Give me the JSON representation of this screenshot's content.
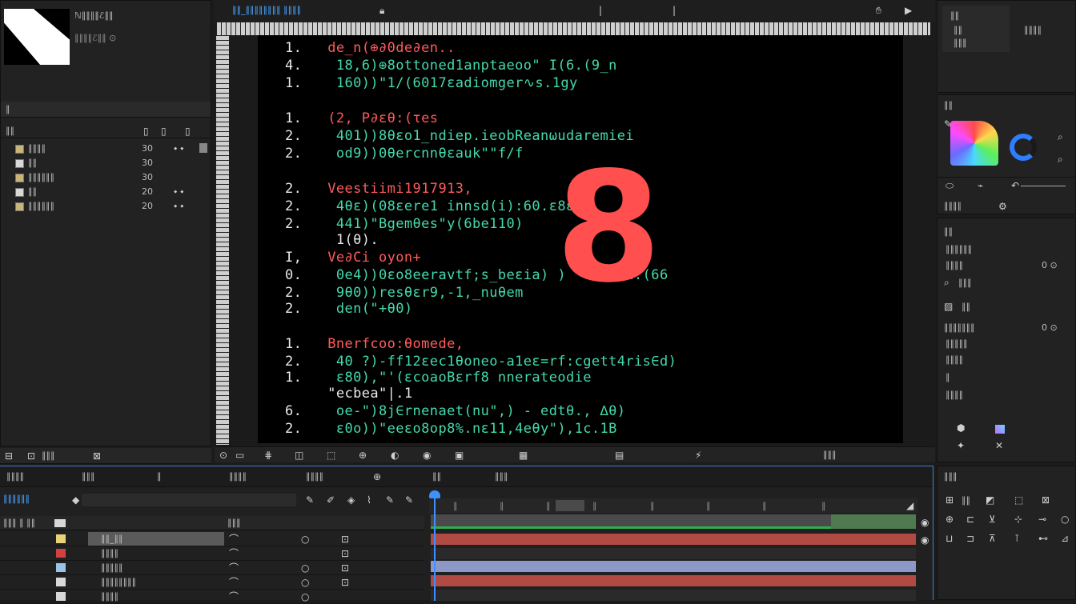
{
  "project_panel": {
    "title": "ℕ∥∥∥∥ℰ∥∥",
    "sub": "∥∥∥∥ℰ∥∥ ⊙",
    "search_label": "∥",
    "col_name": "∥∥",
    "items": [
      {
        "name": "∥∥∥∥",
        "fps": "30"
      },
      {
        "name": "∥∥",
        "fps": "30"
      },
      {
        "name": "∥∥∥∥∥∥",
        "fps": "30"
      },
      {
        "name": "∥∥",
        "fps": "20"
      },
      {
        "name": "∥∥∥∥∥∥",
        "fps": "20"
      }
    ],
    "footer": "∥∥∥"
  },
  "viewer_tab": {
    "label": "∥∥_∥∥∥∥∥∥∥∥ ∥∥∥∥",
    "icon": "lock-icon"
  },
  "code_lines": [
    {
      "num": "1.",
      "text": "de_n(⊕∂0de∂en.."
    },
    {
      "num": "4.",
      "text": " 18,6)⊕8ottoned1anptaeoo\" I(6.(9_n"
    },
    {
      "num": "1.",
      "text": " 160))\"1/(6017εadiomger∿s.1gy"
    },
    {
      "num": "1.",
      "text": "(2, P∂εθ:(τes"
    },
    {
      "num": "2.",
      "text": " 401))8θεo1_ndiep.ieobReanωudaremiei"
    },
    {
      "num": "2.",
      "text": " od9))0θercnnθεauk\"\"f/f"
    },
    {
      "num": "2.",
      "text": "Veestiimi1917913,"
    },
    {
      "num": "2.",
      "text": " 4θε)(08εere1 innsd(i):60.ε8εs"
    },
    {
      "num": "2.",
      "text": " 441)\"Bgemθes\"y(6be110)"
    },
    {
      "num": "",
      "text": "  1(θ)."
    },
    {
      "num": "I,",
      "text": "Ve∂Ci oyon+"
    },
    {
      "num": "0.",
      "text": " 0e4))0εo8eeravtf;s_beεia) ) \"'i1ubε:(66"
    },
    {
      "num": "2.",
      "text": " 9θ0))resθεr9,-1,_nuθem"
    },
    {
      "num": "2.",
      "text": " den(\"+θ0)"
    },
    {
      "num": "1.",
      "text": "Bnerfcoo:θomede,"
    },
    {
      "num": "2.",
      "text": " 40 ?)-ff12εec1θoneo-a1eε=rf:cgett4ris∈d)"
    },
    {
      "num": "1.",
      "text": " ε80),\"'(εcoaoBεrf8 nnerateodie"
    },
    {
      "num": "",
      "text": " \"ecbea\"|.1"
    },
    {
      "num": "6.",
      "text": " oe-\")8j∈rnenaet(nu\",) - edtθ., ∆θ)"
    },
    {
      "num": "2.",
      "text": " ε0o))\"eeεo8op8%.nε11,4eθy\"),1c.1B"
    }
  ],
  "overlay_number": "8",
  "toolbar": {
    "timecode_label": "∥∥∥"
  },
  "right_panels": {
    "info_title": "∥∥",
    "info_sub1": "∥∥",
    "info_sub2": "∥∥∥",
    "info_right": "∥∥∥∥",
    "color_title": "∥∥",
    "effects_title": "∥∥∥∥",
    "props_title": "∥∥",
    "props": [
      "∥∥∥∥∥∥",
      "∥∥∥∥",
      "∥∥∥",
      "∥∥",
      "∥∥∥∥∥∥∥",
      "∥∥∥∥∥",
      "∥∥∥∥",
      "∥",
      "∥∥∥∥"
    ],
    "props_values": [
      "",
      "0 ⊙",
      "",
      "",
      "0 ⊙",
      "",
      "",
      "",
      ""
    ],
    "tools_title": "∥∥∥"
  },
  "timeline": {
    "tabs": [
      {
        "label": "∥∥∥∥"
      },
      {
        "label": "∥∥∥"
      },
      {
        "label": "∥"
      },
      {
        "label": "∥∥∥∥"
      },
      {
        "label": "∥∥∥∥"
      },
      {
        "label": "∥∥"
      },
      {
        "label": "∥∥∥"
      }
    ],
    "timecode": "∥∥∥∥∥∥",
    "col_src": "∥∥∥",
    "layers": [
      {
        "name": "∥∥_∥∥",
        "color": "#e8d27a"
      },
      {
        "name": "∥∥∥∥",
        "color": "#d24141"
      },
      {
        "name": "∥∥∥∥∥",
        "color": "#9cc3e8"
      },
      {
        "name": "∥∥∥∥∥∥∥∥",
        "color": "#d8d8d8"
      },
      {
        "name": "∥∥∥∥",
        "color": "#d8d8d8"
      }
    ],
    "ruler_marks": [
      "∥",
      "∥",
      "∥",
      "∥",
      "∥",
      "∥",
      "∥",
      "∥",
      "∥",
      "∥"
    ]
  }
}
